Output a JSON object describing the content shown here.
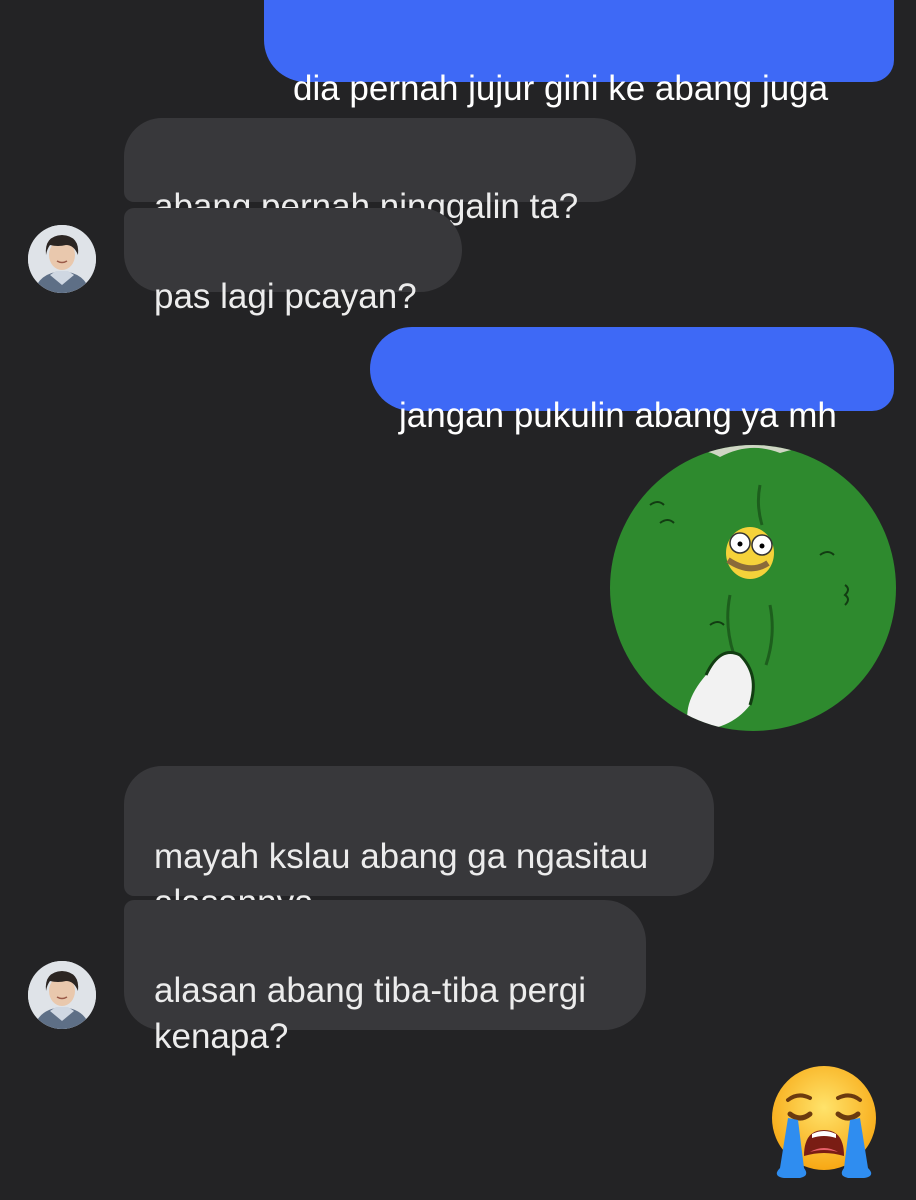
{
  "messages": [
    {
      "side": "sent",
      "text": "dia pernah jujur gini ke abang juga"
    },
    {
      "side": "received",
      "text": "abang pernah ninggalin ta?"
    },
    {
      "side": "received",
      "text": "pas lagi pcayan?"
    },
    {
      "side": "sent",
      "text": "jangan pukulin abang ya mh"
    },
    {
      "side": "sent",
      "sticker": "homer-backing-into-hedge-sticker"
    },
    {
      "side": "received",
      "text": "mayah kslau abang ga ngasitau\nalasannya."
    },
    {
      "side": "received",
      "text": "alasan abang tiba-tiba pergi\nkenapa?"
    },
    {
      "side": "sent",
      "emoji": "loudly-crying-face-emoji"
    }
  ],
  "colors": {
    "background": "#232325",
    "sent_bubble": "#3e69f6",
    "received_bubble": "#38383b",
    "sent_text": "#ffffff",
    "received_text": "#ececec",
    "sticker_green": "#2e8a2e"
  }
}
